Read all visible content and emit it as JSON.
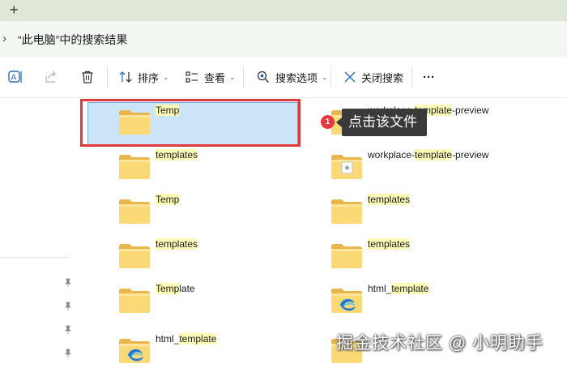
{
  "tabstrip": {
    "new_tab_label": "+"
  },
  "address": {
    "chevron": "›",
    "path": "“此电脑”中的搜索结果"
  },
  "toolbar": {
    "sort_label": "排序",
    "view_label": "查看",
    "search_options_label": "搜索选项",
    "close_search_label": "关闭搜索",
    "more_label": "···"
  },
  "results": {
    "left": [
      {
        "pre": "",
        "hl": "Temp",
        "post": "",
        "icon": "folder-icon"
      },
      {
        "pre": "",
        "hl": "templates",
        "post": "",
        "icon": "folder-icon"
      },
      {
        "pre": "",
        "hl": "Temp",
        "post": "",
        "icon": "folder-icon"
      },
      {
        "pre": "",
        "hl": "templates",
        "post": "",
        "icon": "folder-icon"
      },
      {
        "pre": "",
        "hl": "Temp",
        "post": "late",
        "icon": "folder-icon"
      },
      {
        "pre": "html_",
        "hl": "template",
        "post": "",
        "icon": "folder-edge-icon"
      }
    ],
    "right": [
      {
        "pre": "workplace-",
        "hl": "template",
        "post": "-preview",
        "icon": "folder-icon"
      },
      {
        "pre": "workplace-",
        "hl": "template",
        "post": "-preview",
        "icon": "folder-doc-icon"
      },
      {
        "pre": "",
        "hl": "templates",
        "post": "",
        "icon": "folder-icon"
      },
      {
        "pre": "",
        "hl": "templates",
        "post": "",
        "icon": "folder-icon"
      },
      {
        "pre": "html_",
        "hl": "template",
        "post": "",
        "icon": "folder-edge-icon"
      },
      {
        "pre": "",
        "hl": "",
        "post": "",
        "icon": "folder-icon"
      }
    ]
  },
  "callout": {
    "badge": "1",
    "text": "点击该文件"
  },
  "watermark": "掘金技术社区 @ 小明助手",
  "colors": {
    "highlight": "#fdfbb8",
    "selection": "#cce4f7",
    "annotation_red": "#e23a3a"
  }
}
